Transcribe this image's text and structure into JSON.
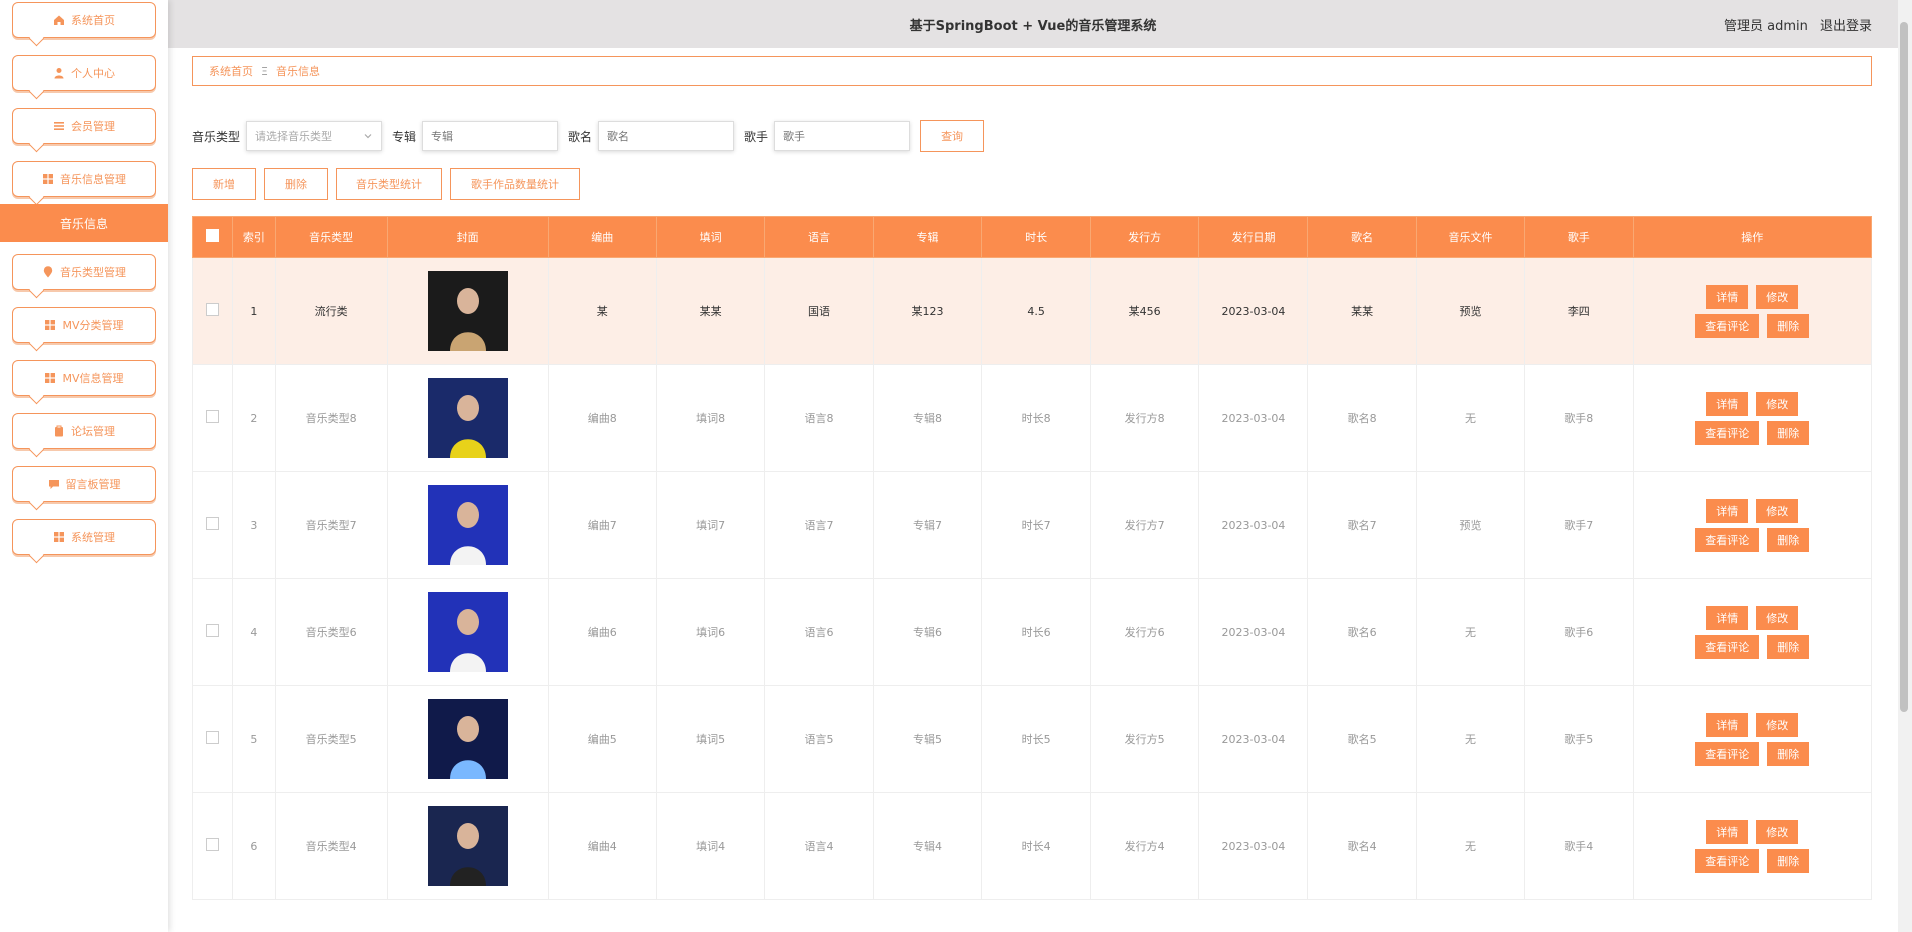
{
  "sidebar": {
    "items": [
      {
        "label": "系统首页",
        "icon": "home-icon"
      },
      {
        "label": "个人中心",
        "icon": "user-icon"
      },
      {
        "label": "会员管理",
        "icon": "list-icon"
      },
      {
        "label": "音乐信息管理",
        "icon": "grid-icon"
      },
      {
        "label": "音乐类型管理",
        "icon": "pin-icon"
      },
      {
        "label": "MV分类管理",
        "icon": "grid-icon"
      },
      {
        "label": "MV信息管理",
        "icon": "grid-icon"
      },
      {
        "label": "论坛管理",
        "icon": "clipboard-icon"
      },
      {
        "label": "留言板管理",
        "icon": "chat-icon"
      },
      {
        "label": "系统管理",
        "icon": "grid-icon"
      }
    ],
    "active_sub": "音乐信息"
  },
  "header": {
    "title": "基于SpringBoot + Vue的音乐管理系统",
    "user_label": "管理员 admin",
    "logout_label": "退出登录"
  },
  "breadcrumb": {
    "home": "系统首页",
    "separator": "Ξ",
    "current": "音乐信息"
  },
  "search": {
    "type_label": "音乐类型",
    "type_placeholder": "请选择音乐类型",
    "album_label": "专辑",
    "album_placeholder": "专辑",
    "song_label": "歌名",
    "song_placeholder": "歌名",
    "singer_label": "歌手",
    "singer_placeholder": "歌手",
    "query_label": "查询"
  },
  "actions": {
    "add": "新增",
    "delete": "删除",
    "type_stats": "音乐类型统计",
    "singer_stats": "歌手作品数量统计"
  },
  "table": {
    "headers": [
      "索引",
      "音乐类型",
      "封面",
      "编曲",
      "填词",
      "语言",
      "专辑",
      "时长",
      "发行方",
      "发行日期",
      "歌名",
      "音乐文件",
      "歌手",
      "操作"
    ],
    "rows": [
      {
        "index": "1",
        "type": "流行类",
        "arranger": "某",
        "lyricist": "某某",
        "language": "国语",
        "album": "某123",
        "duration": "4.5",
        "publisher": "某456",
        "date": "2023-03-04",
        "song": "某某",
        "file": "预览",
        "singer": "李四"
      },
      {
        "index": "2",
        "type": "音乐类型8",
        "arranger": "编曲8",
        "lyricist": "填词8",
        "language": "语言8",
        "album": "专辑8",
        "duration": "时长8",
        "publisher": "发行方8",
        "date": "2023-03-04",
        "song": "歌名8",
        "file": "无",
        "singer": "歌手8"
      },
      {
        "index": "3",
        "type": "音乐类型7",
        "arranger": "编曲7",
        "lyricist": "填词7",
        "language": "语言7",
        "album": "专辑7",
        "duration": "时长7",
        "publisher": "发行方7",
        "date": "2023-03-04",
        "song": "歌名7",
        "file": "预览",
        "singer": "歌手7"
      },
      {
        "index": "4",
        "type": "音乐类型6",
        "arranger": "编曲6",
        "lyricist": "填词6",
        "language": "语言6",
        "album": "专辑6",
        "duration": "时长6",
        "publisher": "发行方6",
        "date": "2023-03-04",
        "song": "歌名6",
        "file": "无",
        "singer": "歌手6"
      },
      {
        "index": "5",
        "type": "音乐类型5",
        "arranger": "编曲5",
        "lyricist": "填词5",
        "language": "语言5",
        "album": "专辑5",
        "duration": "时长5",
        "publisher": "发行方5",
        "date": "2023-03-04",
        "song": "歌名5",
        "file": "无",
        "singer": "歌手5"
      },
      {
        "index": "6",
        "type": "音乐类型4",
        "arranger": "编曲4",
        "lyricist": "填词4",
        "language": "语言4",
        "album": "专辑4",
        "duration": "时长4",
        "publisher": "发行方4",
        "date": "2023-03-04",
        "song": "歌名4",
        "file": "无",
        "singer": "歌手4"
      }
    ],
    "ops": {
      "detail": "详情",
      "edit": "修改",
      "comments": "查看评论",
      "delete": "删除"
    }
  },
  "colors": {
    "accent": "#fb8c4d",
    "highlight_row": "#fdeee6",
    "preview": "#3fbf8f"
  }
}
